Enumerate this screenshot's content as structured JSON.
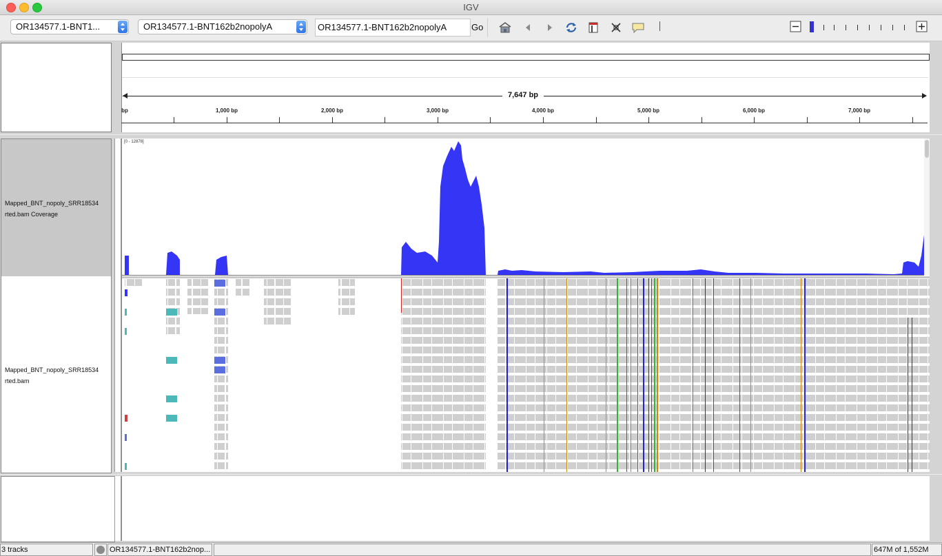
{
  "window": {
    "title": "IGV"
  },
  "toolbar": {
    "genome_combo": "OR134577.1-BNT1...",
    "chrom_combo": "OR134577.1-BNT162b2nopolyA",
    "locus_value": "OR134577.1-BNT162b2nopolyA",
    "go_label": "Go",
    "icons": [
      "home-icon",
      "back-icon",
      "forward-icon",
      "refresh-icon",
      "roi-icon",
      "resize-icon",
      "popup-text-icon"
    ]
  },
  "ruler": {
    "span_label": "7,647 bp",
    "tick_labels": [
      "bp",
      "1,000 bp",
      "2,000 bp",
      "3,000 bp",
      "4,000 bp",
      "5,000 bp",
      "6,000 bp",
      "7,000 bp"
    ]
  },
  "tracks": {
    "coverage": {
      "name_line1": "Mapped_BNT_nopoly_SRR18534",
      "name_line2": "rted.bam Coverage",
      "range": "[0 - 12878]"
    },
    "alignment": {
      "name_line1": "Mapped_BNT_nopoly_SRR18534",
      "name_line2": "rted.bam"
    }
  },
  "colors": {
    "coverage": "#3535f5",
    "read": "#cfcfcf",
    "mismatch_A": "#2fb52f",
    "mismatch_C": "#2222dd",
    "mismatch_G": "#c88a10",
    "mismatch_T": "#dd2222"
  },
  "status": {
    "tracks": "3 tracks",
    "locus": "OR134577.1-BNT162b2nop...",
    "memory": "647M of 1,552M"
  }
}
